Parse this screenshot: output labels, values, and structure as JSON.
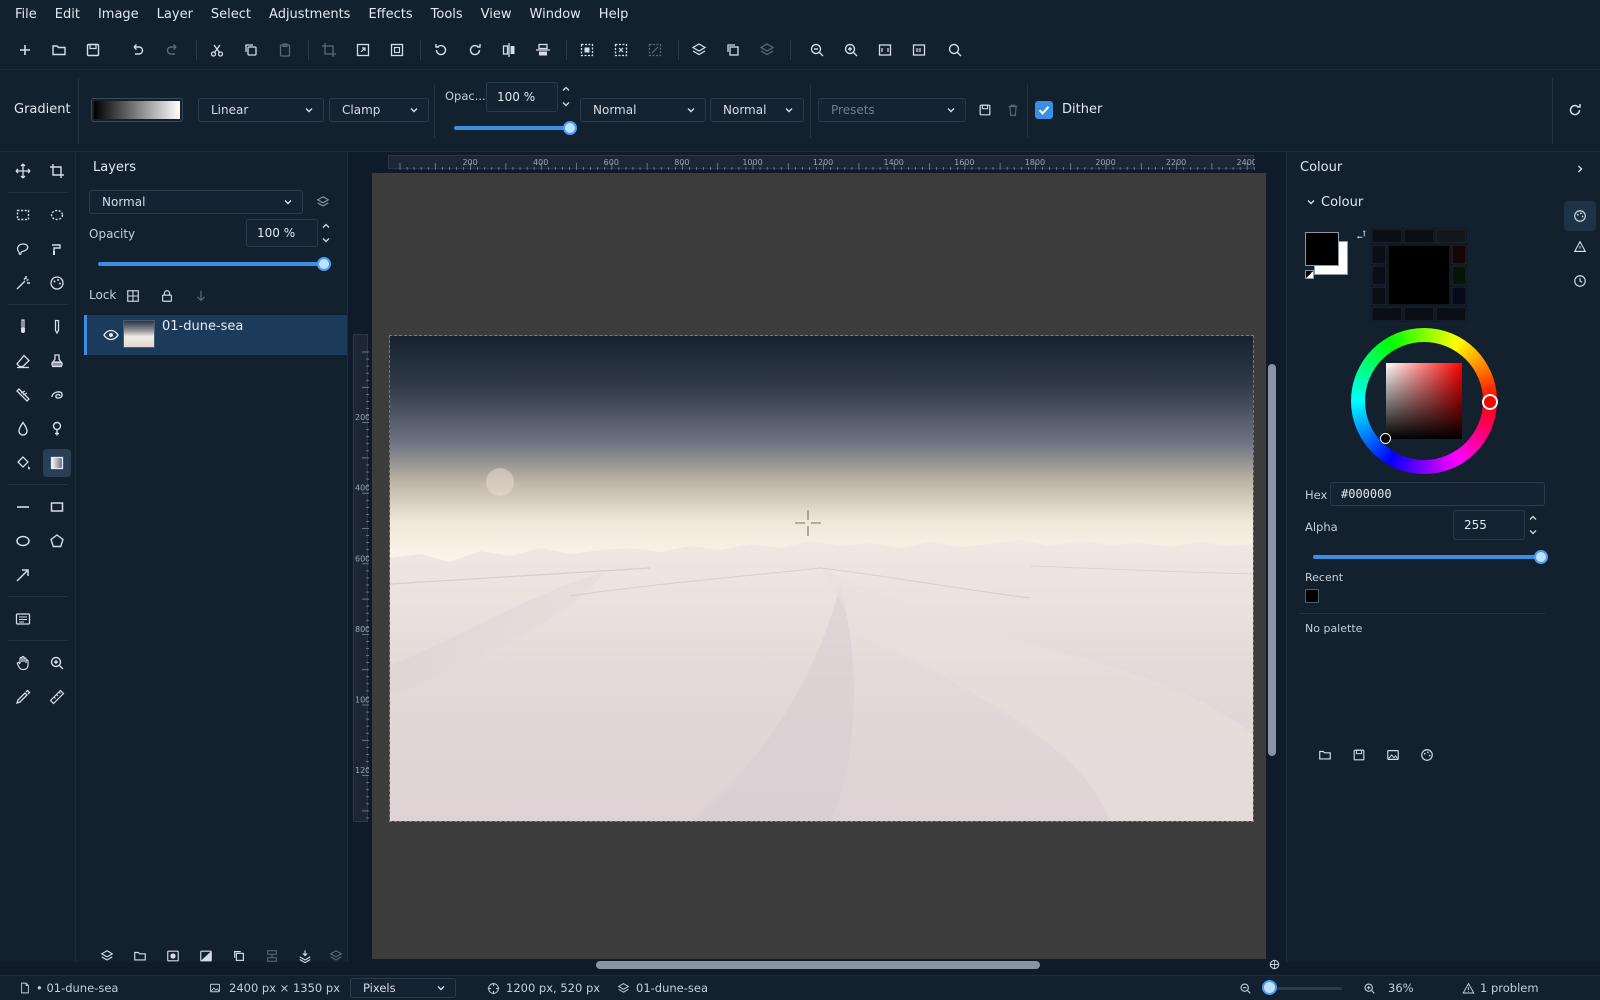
{
  "menu": [
    "File",
    "Edit",
    "Image",
    "Layer",
    "Select",
    "Adjustments",
    "Effects",
    "Tools",
    "View",
    "Window",
    "Help"
  ],
  "options": {
    "tool_name": "Gradient",
    "gradient_type": "Linear",
    "repeat_mode": "Clamp",
    "opacity_label": "Opac...",
    "opacity_value": "100 %",
    "opacity_level": 1.0,
    "blend_mode_1": "Normal",
    "blend_mode_2": "Normal",
    "presets_placeholder": "Presets",
    "dither_label": "Dither",
    "dither_checked": true
  },
  "layers": {
    "title": "Layers",
    "blend_mode": "Normal",
    "opacity_label": "Opacity",
    "opacity_value": "100 %",
    "opacity_level": 1.0,
    "lock_label": "Lock",
    "items": [
      {
        "name": "01-dune-sea",
        "visible": true,
        "selected": true
      }
    ]
  },
  "rulers": {
    "horizontal": [
      "200",
      "400",
      "600",
      "800",
      "1000",
      "1200",
      "1400",
      "1600",
      "1800",
      "2000",
      "2200",
      "2400"
    ],
    "vertical": [
      "200",
      "400",
      "600",
      "800",
      "1000",
      "1200"
    ]
  },
  "colour": {
    "panel_title": "Colour",
    "section_title": "Colour",
    "primary": "#000000",
    "secondary": "#ffffff",
    "hex_label": "Hex",
    "hex_value": "#000000",
    "alpha_label": "Alpha",
    "alpha_value": "255",
    "alpha_level": 1.0,
    "recent_label": "Recent",
    "recent": [
      "#000000"
    ],
    "palette_label": "No palette"
  },
  "status": {
    "document": "• 01-dune-sea",
    "image_size": "2400 px × 1350 px",
    "units": "Pixels",
    "cursor_position": "1200 px, 520 px",
    "active_layer": "01-dune-sea",
    "zoom": "36%",
    "problems": "1 problem"
  }
}
